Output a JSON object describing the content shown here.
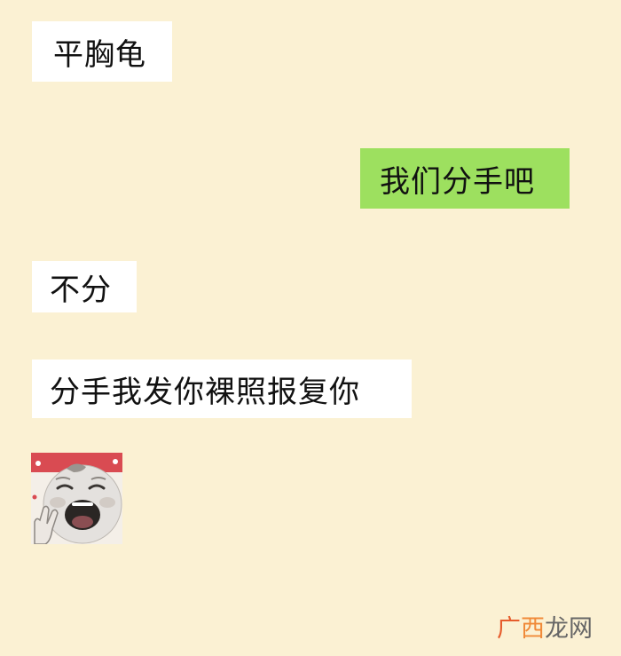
{
  "chat": {
    "messages": [
      {
        "side": "received",
        "text": "平胸龟"
      },
      {
        "side": "sent",
        "text": "我们分手吧"
      },
      {
        "side": "received",
        "text": "不分"
      },
      {
        "side": "received",
        "text": "分手我发你裸照报复你"
      }
    ],
    "sticker": {
      "icon": "crying-baby-sticker-icon"
    }
  },
  "watermark": {
    "part1": "广",
    "part2": "西",
    "part3": "龙网"
  },
  "colors": {
    "background": "#fbf1d3",
    "received_bubble": "#ffffff",
    "sent_bubble": "#9de05f",
    "watermark_red": "#e65c2c",
    "watermark_orange": "#f08a38"
  }
}
